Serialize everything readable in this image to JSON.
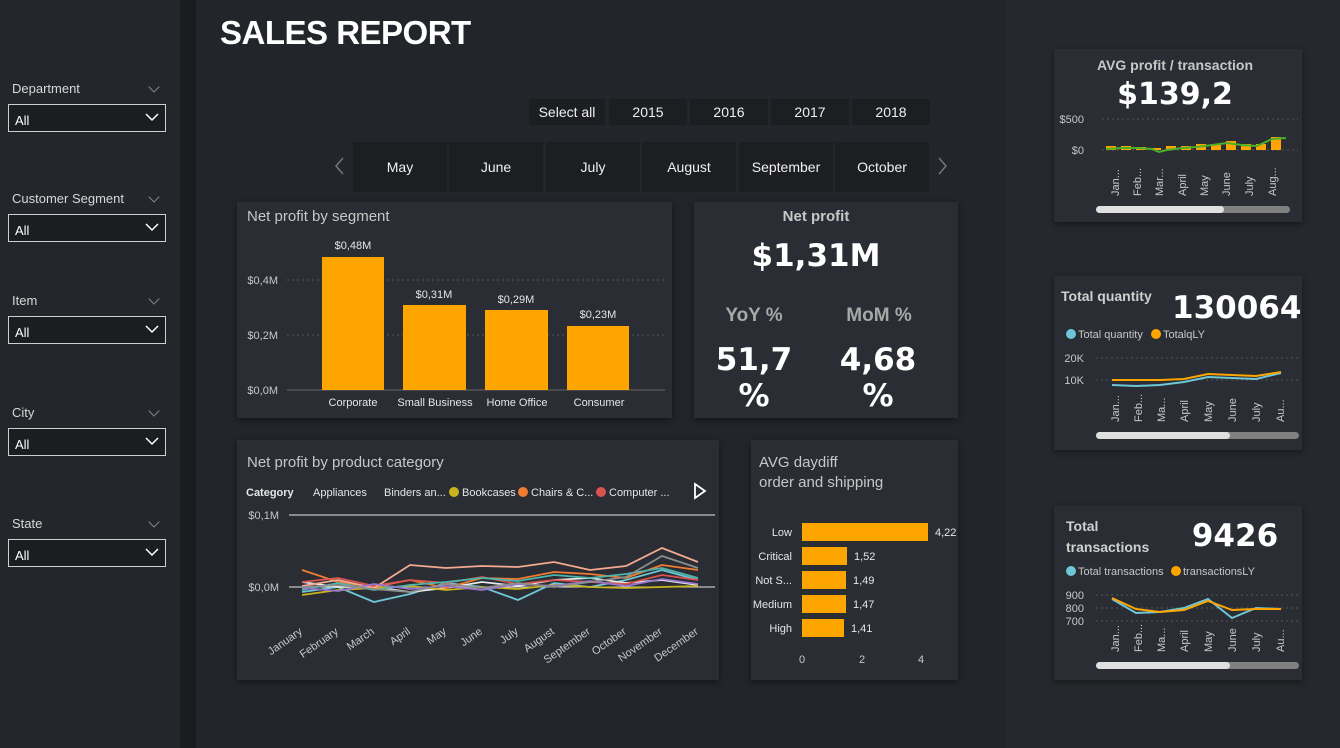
{
  "report_title": "SALES REPORT",
  "filters": [
    {
      "label": "Department",
      "value": "All"
    },
    {
      "label": "Customer Segment",
      "value": "All"
    },
    {
      "label": "Item",
      "value": "All"
    },
    {
      "label": "City",
      "value": "All"
    },
    {
      "label": "State",
      "value": "All"
    }
  ],
  "years": [
    "Select all",
    "2015",
    "2016",
    "2017",
    "2018"
  ],
  "months": [
    "May",
    "June",
    "July",
    "August",
    "September",
    "October"
  ],
  "segment_chart": {
    "title": "Net profit by segment",
    "categories": [
      "Corporate",
      "Small Business",
      "Home Office",
      "Consumer"
    ],
    "labels": [
      "$0,48M",
      "$0,31M",
      "$0,29M",
      "$0,23M"
    ],
    "yticks": [
      "$0,4M",
      "$0,2M",
      "$0,0M"
    ]
  },
  "net_profit": {
    "title": "Net profit",
    "value": "$1,31M",
    "yoy_label": "YoY %",
    "yoy_value": "51,7 %",
    "mom_label": "MoM %",
    "mom_value": "4,68 %"
  },
  "category_chart": {
    "title": "Net profit by product category",
    "legend_title": "Category",
    "legend": [
      "Appliances",
      "Binders an...",
      "Bookcases",
      "Chairs & C...",
      "Computer ..."
    ],
    "legend_colors": [
      "#6ec6d8",
      "#e8e8e8",
      "#c9b41f",
      "#f07c2f",
      "#d9534f"
    ],
    "yticks": [
      "$0,1M",
      "$0,0M"
    ],
    "months": [
      "January",
      "February",
      "March",
      "April",
      "May",
      "June",
      "July",
      "August",
      "September",
      "October",
      "November",
      "December"
    ]
  },
  "daydiff": {
    "title_line1": "AVG daydiff",
    "title_line2": "order and shipping",
    "categories": [
      "Low",
      "Critical",
      "Not S...",
      "Medium",
      "High"
    ],
    "labels": [
      "4,22",
      "1,52",
      "1,49",
      "1,47",
      "1,41"
    ],
    "xticks": [
      "0",
      "2",
      "4"
    ]
  },
  "avg_profit": {
    "title": "AVG profit / transaction",
    "value": "$139,2",
    "yticks": [
      "$500",
      "$0"
    ],
    "months": [
      "Jan...",
      "Feb...",
      "Mar...",
      "April",
      "May",
      "June",
      "July",
      "Aug..."
    ]
  },
  "total_quantity": {
    "title": "Total quantity",
    "value": "130064",
    "legend": [
      "Total quantity",
      "TotalqLY"
    ],
    "yticks": [
      "20K",
      "10K"
    ],
    "months": [
      "Jan...",
      "Feb...",
      "Ma...",
      "April",
      "May",
      "June",
      "July",
      "Au..."
    ]
  },
  "total_transactions": {
    "title_line1": "Total",
    "title_line2": "transactions",
    "value": "9426",
    "legend": [
      "Total transactions",
      "transactionsLY"
    ],
    "yticks": [
      "900",
      "800",
      "700"
    ],
    "months": [
      "Jan...",
      "Feb...",
      "Ma...",
      "April",
      "May",
      "June",
      "July",
      "Au..."
    ]
  },
  "colors": {
    "accent": "#ffa500",
    "teal": "#6ec6d8",
    "green": "#4caf2a"
  },
  "chart_data": [
    {
      "type": "bar",
      "title": "Net profit by segment",
      "categories": [
        "Corporate",
        "Small Business",
        "Home Office",
        "Consumer"
      ],
      "values": [
        0.48,
        0.31,
        0.29,
        0.23
      ],
      "ylim": [
        0,
        0.5
      ]
    },
    {
      "type": "bar",
      "title": "AVG daydiff order and shipping",
      "categories": [
        "Low",
        "Critical",
        "Not S...",
        "Medium",
        "High"
      ],
      "values": [
        4.22,
        1.52,
        1.49,
        1.47,
        1.41
      ],
      "xlim": [
        0,
        4.4
      ]
    },
    {
      "type": "line",
      "title": "Total quantity",
      "x": [
        "Jan",
        "Feb",
        "Mar",
        "April",
        "May",
        "June",
        "July",
        "Aug"
      ],
      "series": [
        {
          "name": "Total quantity",
          "values": [
            7500,
            7000,
            7200,
            8000,
            10500,
            10000,
            9500,
            11500
          ]
        },
        {
          "name": "TotalqLY",
          "values": [
            9500,
            9500,
            9600,
            10000,
            12000,
            11500,
            11000,
            13000
          ]
        }
      ]
    },
    {
      "type": "line",
      "title": "Total transactions",
      "x": [
        "Jan",
        "Feb",
        "Mar",
        "April",
        "May",
        "June",
        "July",
        "Aug"
      ],
      "series": [
        {
          "name": "Total transactions",
          "values": [
            860,
            760,
            770,
            800,
            870,
            720,
            800,
            790
          ]
        },
        {
          "name": "transactionsLY",
          "values": [
            870,
            790,
            760,
            780,
            860,
            780,
            790,
            790
          ]
        }
      ]
    }
  ]
}
